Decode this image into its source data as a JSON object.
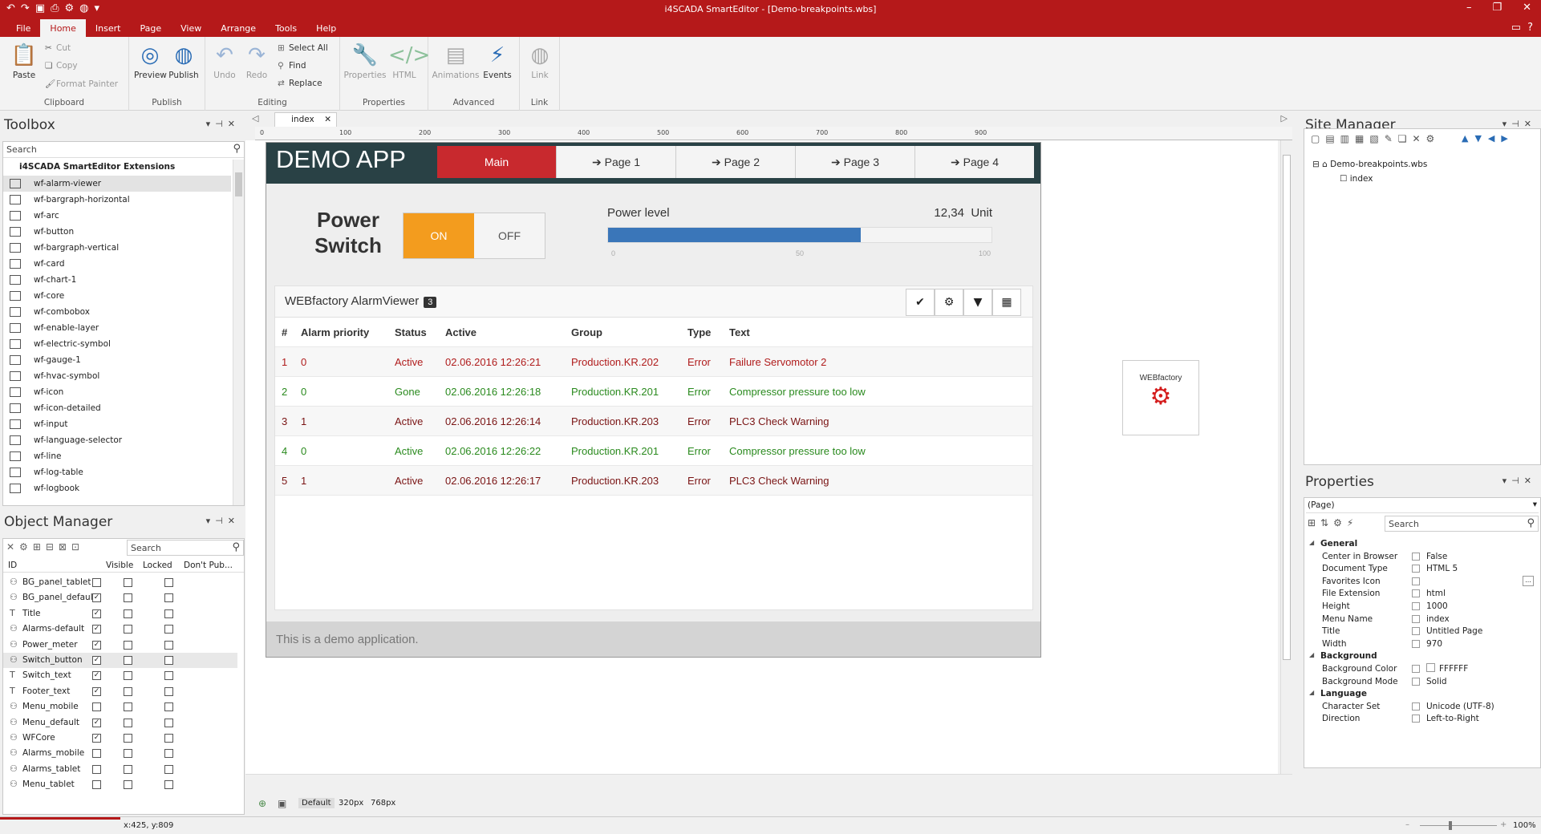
{
  "app": {
    "title": "i4SCADA SmartEditor - [Demo-breakpoints.wbs]"
  },
  "ribbon_tabs": [
    "File",
    "Home",
    "Insert",
    "Page",
    "View",
    "Arrange",
    "Tools",
    "Help"
  ],
  "ribbon": {
    "clipboard": {
      "paste": "Paste",
      "cut": "Cut",
      "copy": "Copy",
      "format_painter": "Format Painter",
      "label": "Clipboard"
    },
    "publish": {
      "preview": "Preview",
      "publish": "Publish",
      "label": "Publish"
    },
    "editing": {
      "undo": "Undo",
      "redo": "Redo",
      "select_all": "Select All",
      "find": "Find",
      "replace": "Replace",
      "label": "Editing"
    },
    "properties": {
      "properties": "Properties",
      "html": "HTML",
      "label": "Properties"
    },
    "advanced": {
      "animations": "Animations",
      "events": "Events",
      "label": "Advanced"
    },
    "link": {
      "link": "Link",
      "label": "Link"
    }
  },
  "toolbox": {
    "title": "Toolbox",
    "search_placeholder": "Search",
    "group": "i4SCADA SmartEditor Extensions",
    "items": [
      "wf-alarm-viewer",
      "wf-bargraph-horizontal",
      "wf-arc",
      "wf-button",
      "wf-bargraph-vertical",
      "wf-card",
      "wf-chart-1",
      "wf-core",
      "wf-combobox",
      "wf-enable-layer",
      "wf-electric-symbol",
      "wf-gauge-1",
      "wf-hvac-symbol",
      "wf-icon",
      "wf-icon-detailed",
      "wf-input",
      "wf-language-selector",
      "wf-line",
      "wf-log-table",
      "wf-logbook"
    ]
  },
  "object_manager": {
    "title": "Object Manager",
    "search_placeholder": "Search",
    "columns": [
      "ID",
      "Visible",
      "Locked",
      "Don't Pub..."
    ],
    "rows": [
      {
        "id": "BG_panel_tablet",
        "visible": false
      },
      {
        "id": "BG_panel_default",
        "visible": true
      },
      {
        "id": "Title",
        "visible": true
      },
      {
        "id": "Alarms-default",
        "visible": true
      },
      {
        "id": "Power_meter",
        "visible": true
      },
      {
        "id": "Switch_button",
        "visible": true
      },
      {
        "id": "Switch_text",
        "visible": true
      },
      {
        "id": "Footer_text",
        "visible": true
      },
      {
        "id": "Menu_mobile",
        "visible": false
      },
      {
        "id": "Menu_default",
        "visible": true
      },
      {
        "id": "WFCore",
        "visible": true
      },
      {
        "id": "Alarms_mobile",
        "visible": false
      },
      {
        "id": "Alarms_tablet",
        "visible": false
      },
      {
        "id": "Menu_tablet",
        "visible": false
      }
    ]
  },
  "editor": {
    "tab": "index",
    "ruler_ticks": [
      "0",
      "100",
      "200",
      "300",
      "400",
      "500",
      "600",
      "700",
      "800",
      "900"
    ],
    "vruler_ticks": [
      "100",
      "200",
      "300",
      "400",
      "500",
      "600",
      "700"
    ],
    "breakpoints": [
      "Default",
      "320px",
      "768px"
    ]
  },
  "demo": {
    "title": "DEMO APP",
    "nav": [
      "Main",
      "Page 1",
      "Page 2",
      "Page 3",
      "Page 4"
    ],
    "power_switch": "Power Switch",
    "on": "ON",
    "off": "OFF",
    "power_level_label": "Power level",
    "power_value": "12,34",
    "power_unit": "Unit",
    "power_ticks": [
      "0",
      "50",
      "100"
    ],
    "power_fill_fraction": 0.66,
    "alarm_viewer_title": "WEBfactory AlarmViewer",
    "alarm_count": "3",
    "alarm_headers": [
      "#",
      "Alarm priority",
      "Status",
      "Active",
      "Group",
      "Type",
      "Text"
    ],
    "alarms": [
      {
        "n": "1",
        "prio": "0",
        "status": "Active",
        "active": "02.06.2016 12:26:21",
        "group": "Production.KR.202",
        "type": "Error",
        "text": "Failure Servomotor 2",
        "color": "#b01c1c"
      },
      {
        "n": "2",
        "prio": "0",
        "status": "Gone",
        "active": "02.06.2016 12:26:18",
        "group": "Production.KR.201",
        "type": "Error",
        "text": "Compressor pressure too low",
        "color": "#2a8a1e"
      },
      {
        "n": "3",
        "prio": "1",
        "status": "Active",
        "active": "02.06.2016 12:26:14",
        "group": "Production.KR.203",
        "type": "Error",
        "text": "PLC3 Check Warning",
        "color": "#7a1414"
      },
      {
        "n": "4",
        "prio": "0",
        "status": "Active",
        "active": "02.06.2016 12:26:22",
        "group": "Production.KR.201",
        "type": "Error",
        "text": "Compressor pressure too low",
        "color": "#2a8a1e"
      },
      {
        "n": "5",
        "prio": "1",
        "status": "Active",
        "active": "02.06.2016 12:26:17",
        "group": "Production.KR.203",
        "type": "Error",
        "text": "PLC3 Check Warning",
        "color": "#7a1414"
      }
    ],
    "footer": "This is a demo application.",
    "logo_text": "WEBfactory"
  },
  "site_manager": {
    "title": "Site Manager",
    "root": "Demo-breakpoints.wbs",
    "child": "index"
  },
  "properties": {
    "title": "Properties",
    "selector": "(Page)",
    "search_placeholder": "Search",
    "rows": [
      {
        "cat": true,
        "k": "General"
      },
      {
        "k": "Center in Browser",
        "v": "False"
      },
      {
        "k": "Document Type",
        "v": "HTML 5"
      },
      {
        "k": "Favorites Icon",
        "v": ""
      },
      {
        "k": "File Extension",
        "v": "html"
      },
      {
        "k": "Height",
        "v": "1000"
      },
      {
        "k": "Menu Name",
        "v": "index"
      },
      {
        "k": "Title",
        "v": "Untitled Page"
      },
      {
        "k": "Width",
        "v": "970"
      },
      {
        "cat": true,
        "k": "Background"
      },
      {
        "k": "Background Color",
        "v": "FFFFFF"
      },
      {
        "k": "Background Mode",
        "v": "Solid"
      },
      {
        "cat": true,
        "k": "Language"
      },
      {
        "k": "Character Set",
        "v": "Unicode (UTF-8)"
      },
      {
        "k": "Direction",
        "v": "Left-to-Right"
      }
    ]
  },
  "status": {
    "coords": "x:425, y:809",
    "zoom": "100%"
  },
  "colors": {
    "brand": "#b5191a",
    "nav_active": "#c8292e",
    "switch_on": "#f39c1e",
    "bar_fill": "#3a76b9"
  }
}
